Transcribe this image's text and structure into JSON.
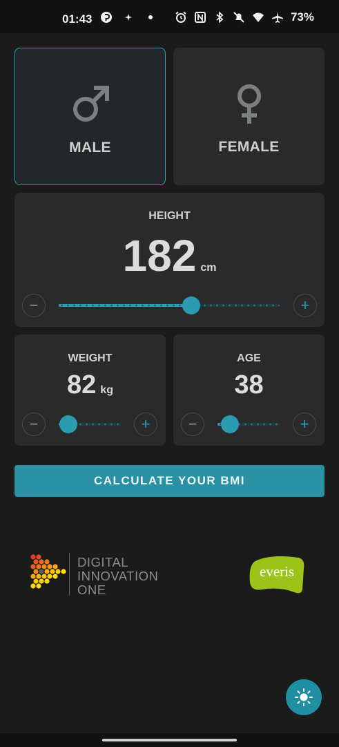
{
  "status_bar": {
    "time": "01:43",
    "battery": "73%",
    "icons_left": [
      "pinterest-like-icon",
      "sparkle-icon",
      "dot-icon"
    ],
    "icons_right": [
      "alarm-icon",
      "nfc-icon",
      "bluetooth-icon",
      "mute-icon",
      "wifi-icon",
      "airplane-icon"
    ]
  },
  "gender": {
    "male_label": "MALE",
    "female_label": "FEMALE",
    "selected": "male"
  },
  "height": {
    "label": "HEIGHT",
    "value": "182",
    "unit": "cm",
    "slider_fraction": 0.6
  },
  "weight": {
    "label": "WEIGHT",
    "value": "82",
    "unit": "kg",
    "slider_fraction": 0.15
  },
  "age": {
    "label": "AGE",
    "value": "38",
    "slider_fraction": 0.2
  },
  "buttons": {
    "minus": "−",
    "plus": "+",
    "calculate": "CALCULATE YOUR BMI"
  },
  "logos": {
    "dio_line1": "DIGITAL",
    "dio_line2": "INNOVATION",
    "dio_line3": "ONE",
    "everis": "everis"
  },
  "colors": {
    "accent": "#2aa0b4",
    "card": "#2a2a2a",
    "background": "#1b1b1b",
    "everis_green": "#9cc31a"
  }
}
